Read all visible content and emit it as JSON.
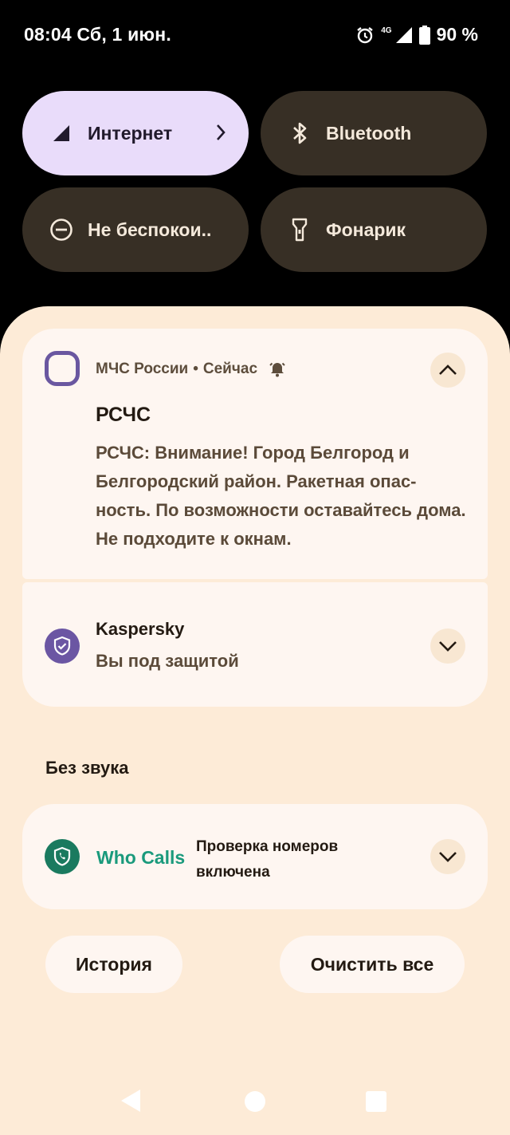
{
  "status_bar": {
    "time_date": "08:04 Сб, 1 июн.",
    "network": "4G",
    "battery": "90 %",
    "icons": [
      "alarm-icon",
      "signal-icon",
      "battery-icon"
    ]
  },
  "quick_tiles": [
    {
      "label": "Интернет",
      "icon": "signal-icon",
      "active": true
    },
    {
      "label": "Bluetooth",
      "icon": "bluetooth-icon",
      "active": false
    },
    {
      "label": "Не беспокои..",
      "icon": "dnd-icon",
      "active": false
    },
    {
      "label": "Фонарик",
      "icon": "flashlight-icon",
      "active": false
    }
  ],
  "notifications": {
    "mchs": {
      "app": "МЧС России",
      "separator": "•",
      "time": "Сейчас",
      "title": "РСЧС",
      "text": "РСЧС: Внимание!  Город Белгород и Белгородский район. Ракетная опас-ность. По возможности оставайтесь дома. Не подходите к окнам."
    },
    "kaspersky": {
      "title": "Kaspersky",
      "text": "Вы под защитой"
    }
  },
  "silent_section": {
    "header": "Без звука",
    "who_calls": {
      "app": "Who Calls",
      "text": "Проверка номеров включена"
    }
  },
  "buttons": {
    "history": "История",
    "clear_all": "Очистить все"
  },
  "colors": {
    "shade_bg": "#fdebd7",
    "card_bg": "#fef6f1",
    "tile_dark": "#372f25",
    "tile_active": "#e9dcfa",
    "accent_purple": "#6a57a0",
    "accent_green": "#1a9a7c"
  }
}
